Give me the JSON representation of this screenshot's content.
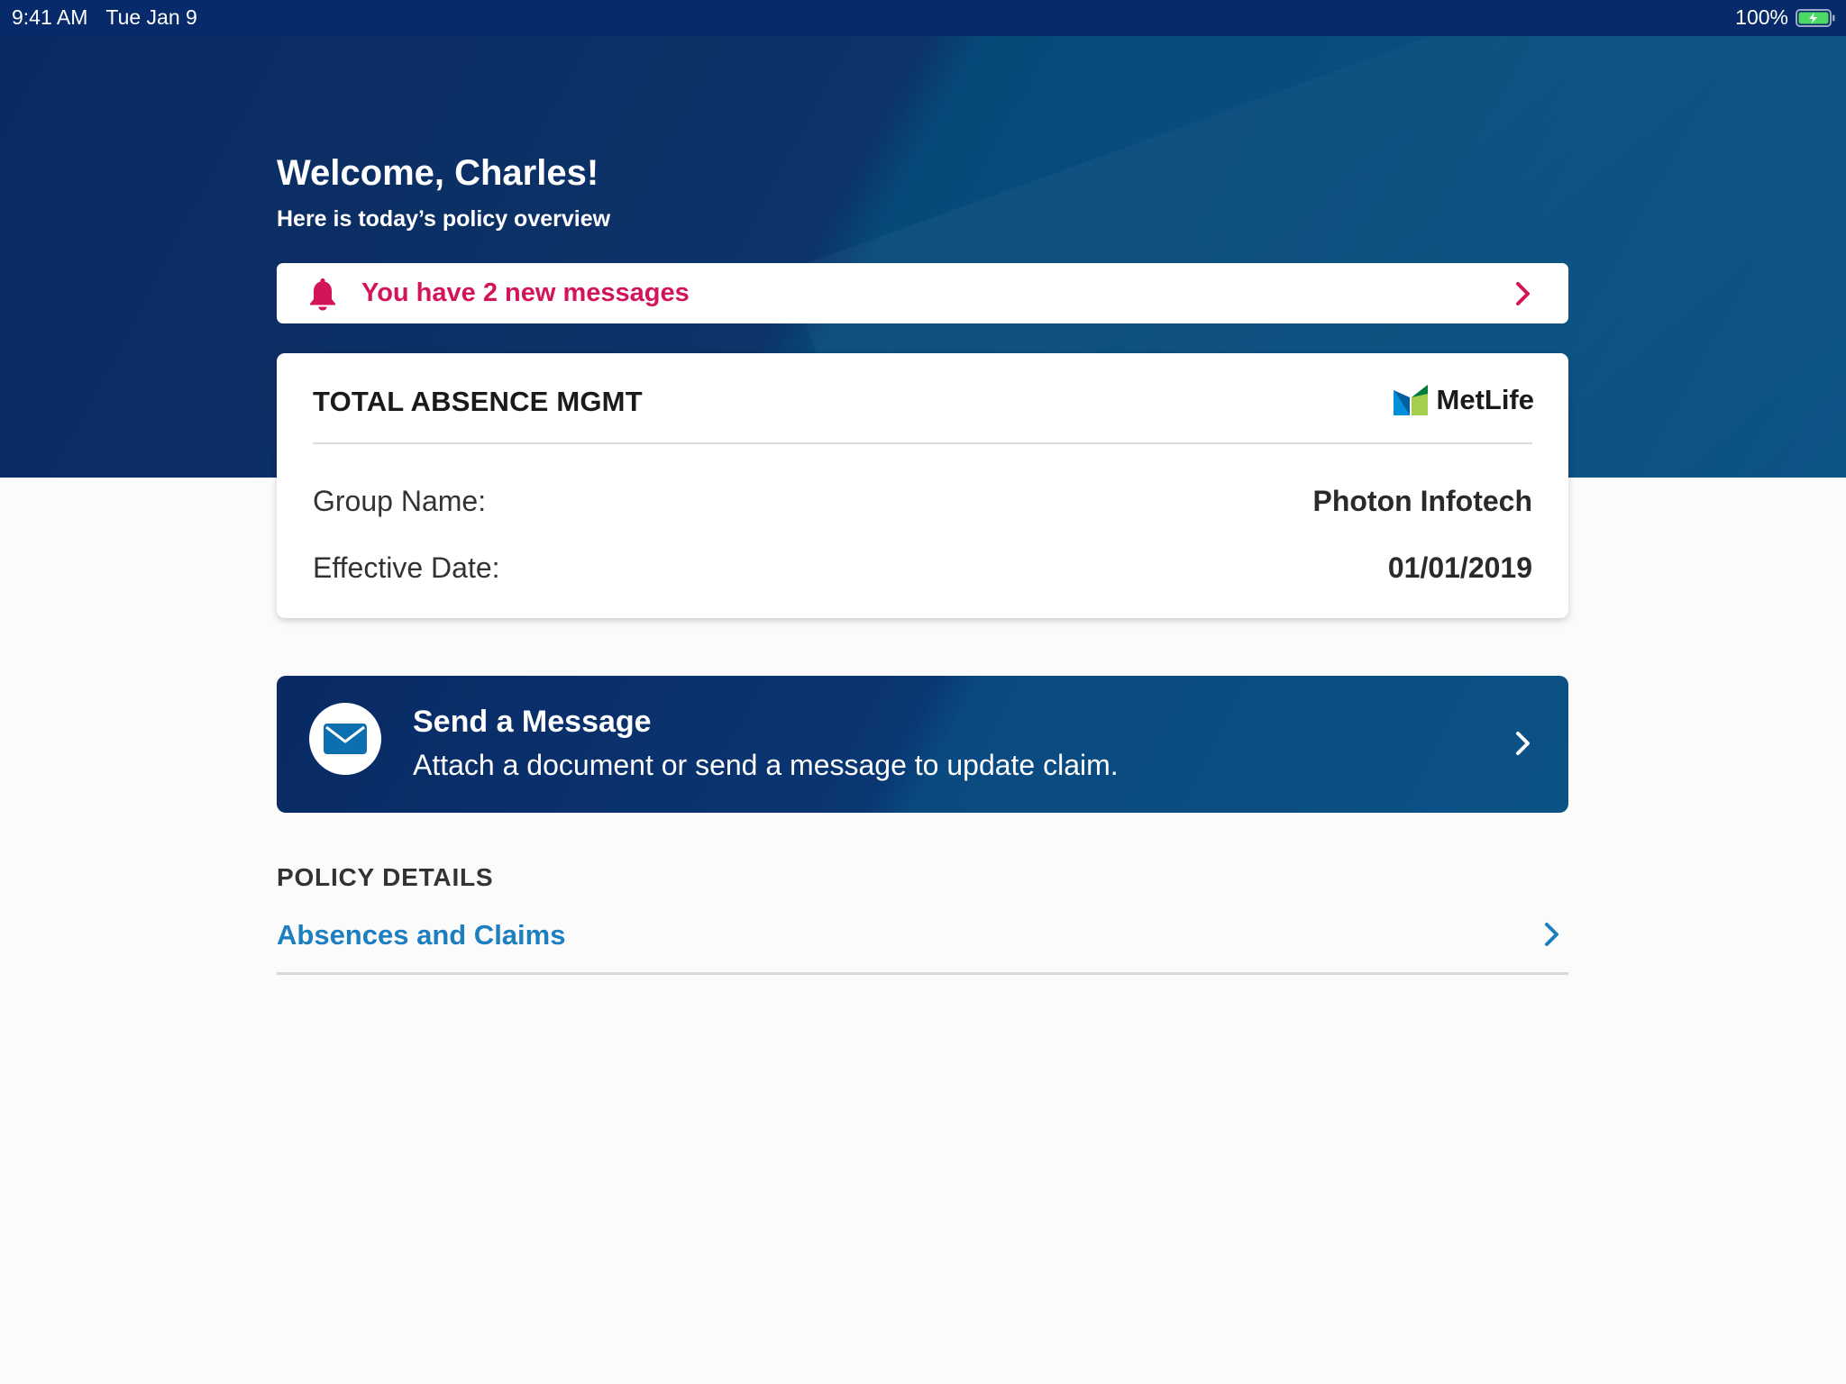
{
  "status_bar": {
    "time": "9:41 AM",
    "date": "Tue Jan 9",
    "battery_percent": "100%",
    "battery_level": 1.0
  },
  "header": {
    "greeting": "Welcome, Charles!",
    "subtitle": "Here is today’s policy overview"
  },
  "messages_banner": {
    "text": "You have 2 new messages",
    "icon": "bell-icon",
    "color": "#d4145a"
  },
  "policy_card": {
    "title": "TOTAL ABSENCE MGMT",
    "logo_text": "MetLife",
    "rows": [
      {
        "label": "Group Name:",
        "value": "Photon Infotech"
      },
      {
        "label": "Effective Date:",
        "value": "01/01/2019"
      }
    ]
  },
  "send_message": {
    "title": "Send a Message",
    "subtitle": "Attach a document or send a message to update claim.",
    "icon": "envelope-icon"
  },
  "policy_details": {
    "header": "POLICY DETAILS",
    "items": [
      {
        "label": "Absences and Claims",
        "icon": "chevron-right-icon"
      }
    ]
  },
  "colors": {
    "brand_navy": "#0a2a62",
    "alert_pink": "#d4145a",
    "link_blue": "#1d7fbf",
    "metlife_blue": "#0090da",
    "metlife_green": "#a4ce4e"
  }
}
